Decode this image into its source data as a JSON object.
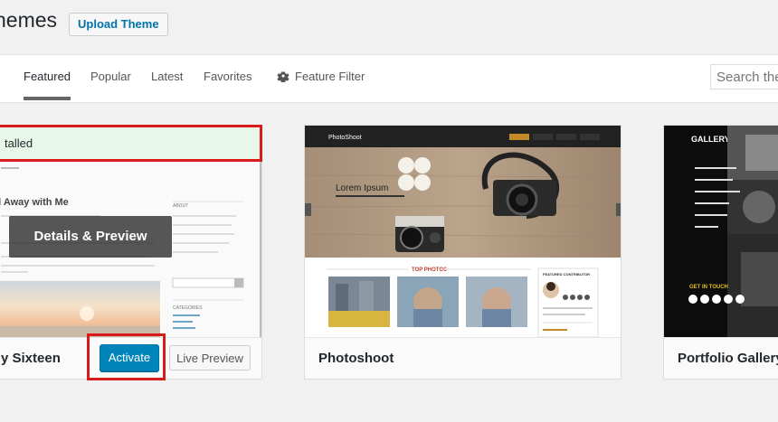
{
  "header": {
    "title": "hemes",
    "upload_label": "Upload Theme"
  },
  "tabs": [
    {
      "label": "Featured"
    },
    {
      "label": "Popular"
    },
    {
      "label": "Latest"
    },
    {
      "label": "Favorites"
    },
    {
      "label": "Feature Filter"
    }
  ],
  "search": {
    "placeholder": "Search the"
  },
  "themes": [
    {
      "name": "y Sixteen",
      "notice": "talled",
      "overlay": "Details & Preview",
      "post_title": "ail Away with Me",
      "activate_label": "Activate",
      "preview_label": "Live Preview"
    },
    {
      "name": "Photoshoot",
      "brand": "PhotoShoot",
      "hero_title": "Lorem Ipsum",
      "section_title": "TOP PHOTOS",
      "side_title": "FEATURED CONTRIBUTOR"
    },
    {
      "name": "Portfolio Gallery",
      "logo": "GALLERY",
      "cta": "GET IN TOUCH"
    }
  ]
}
